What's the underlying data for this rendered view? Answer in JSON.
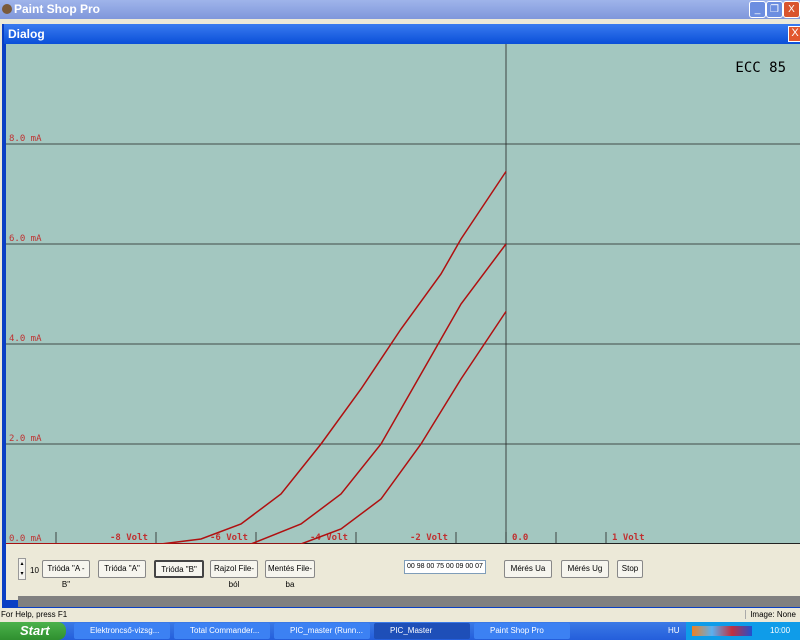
{
  "app": {
    "title": "Paint Shop Pro",
    "minimize": "_",
    "restore": "❐",
    "close": "X"
  },
  "dialog": {
    "title": "Dialog",
    "close": "X"
  },
  "chart_data": {
    "type": "line",
    "title": "ECC 85",
    "y_tick_labels": [
      "0.0 mA",
      "2.0 mA",
      "4.0 mA",
      "6.0 mA",
      "8.0 mA"
    ],
    "y_ticks": [
      0,
      2,
      4,
      6,
      8
    ],
    "x_tick_labels": [
      "-8 Volt",
      "-6 Volt",
      "-4 Volt",
      "-2 Volt",
      "0.0",
      "1 Volt"
    ],
    "xlim": [
      -10,
      5.8
    ],
    "ylim": [
      0,
      10
    ],
    "grid": true,
    "line_color": "#b01010",
    "background": "#a3c7c0",
    "series": [
      {
        "x": [
          -10,
          -6.9,
          -6.1,
          -5.3,
          -4.5,
          -3.7,
          -2.9,
          -2.1,
          -1.3,
          -0.9,
          -0.5,
          0
        ],
        "y": [
          0,
          0,
          0.1,
          0.4,
          1.0,
          2.0,
          3.1,
          4.3,
          5.4,
          6.1,
          6.7,
          7.45
        ]
      },
      {
        "x": [
          -10,
          -5.1,
          -4.1,
          -3.3,
          -2.5,
          -1.7,
          -0.9,
          0
        ],
        "y": [
          0,
          0,
          0.4,
          1.0,
          2.0,
          3.4,
          4.8,
          6.0
        ]
      },
      {
        "x": [
          -10,
          -4.1,
          -3.3,
          -2.5,
          -1.7,
          -0.9,
          0
        ],
        "y": [
          0,
          0,
          0.3,
          0.9,
          2.0,
          3.3,
          4.65
        ]
      }
    ]
  },
  "controls": {
    "spin_value": "10",
    "buttons": [
      "Trióda \"A - B\"",
      "Trióda  \"A\"",
      "Trióda  \"B\"",
      "Rajzol File-ból",
      "Mentés File-ba"
    ],
    "hex_value": "00 98 00 75 00 09 00 07",
    "measure_ua": "Mérés Ua",
    "measure_ug": "Mérés Ug",
    "stop": "Stop"
  },
  "status": {
    "help": "For Help, press F1",
    "image": "Image: None"
  },
  "taskbar": {
    "start": "Start",
    "tasks": [
      "Elektroncső-vizsg...",
      "Total Commander...",
      "PIC_master (Runn...",
      "PIC_Master",
      "Paint Shop Pro"
    ],
    "lang": "HU",
    "clock": "10:00"
  }
}
